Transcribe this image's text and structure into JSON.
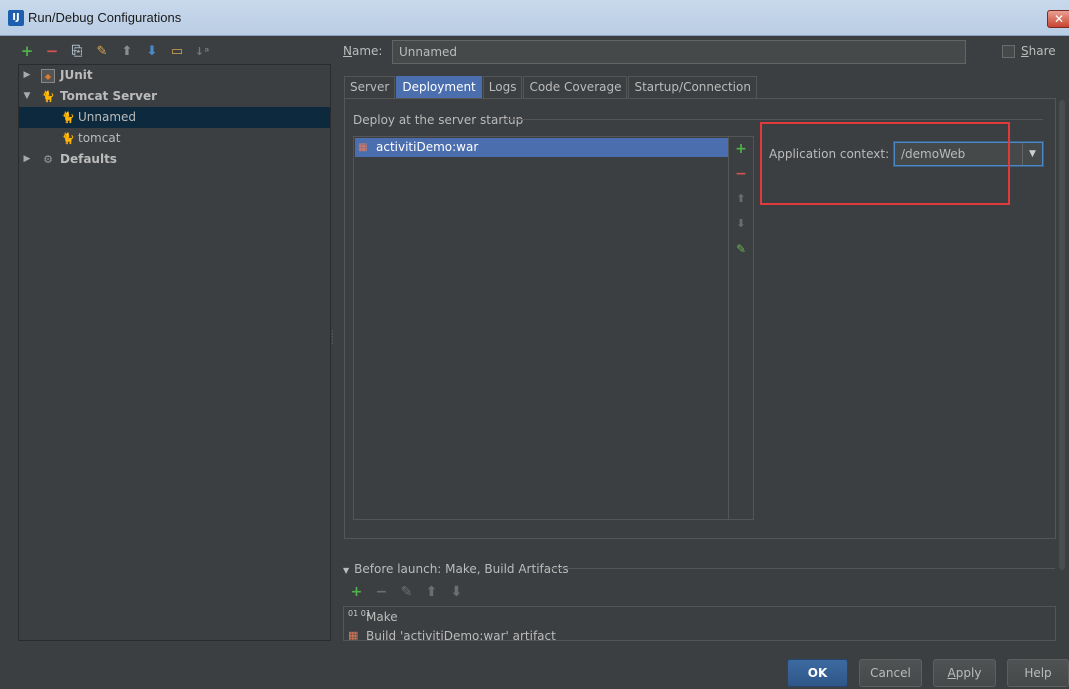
{
  "window": {
    "title": "Run/Debug Configurations",
    "app_icon": "IJ",
    "close_glyph": "✕"
  },
  "left_toolbar": {
    "icons": [
      "add-icon",
      "remove-icon",
      "copy-icon",
      "wrench-icon",
      "move-up-icon",
      "move-down-icon",
      "folder-icon",
      "sort-icon"
    ],
    "glyphs": {
      "add": "+",
      "remove": "−",
      "copy": "⎘",
      "wrench": "✎",
      "up": "⬆",
      "down": "⬇",
      "folder": "▭",
      "sort": "↓ᵃ"
    }
  },
  "tree": {
    "items": [
      {
        "label": "JUnit",
        "bold": true,
        "expanded": false,
        "icon": "junit-icon"
      },
      {
        "label": "Tomcat Server",
        "bold": true,
        "expanded": true,
        "icon": "tomcat-icon"
      },
      {
        "label": "Unnamed",
        "bold": false,
        "selected": true,
        "icon": "tomcat-icon"
      },
      {
        "label": "tomcat",
        "bold": false,
        "icon": "tomcat-icon"
      },
      {
        "label": "Defaults",
        "bold": true,
        "expanded": false,
        "icon": "gear-icon"
      }
    ],
    "arrow_collapsed": "▶",
    "arrow_expanded": "▼"
  },
  "name_field": {
    "label_prefix": "N",
    "label_rest": "ame:",
    "value": "Unnamed"
  },
  "share": {
    "label_prefix": "S",
    "label_rest": "hare",
    "checked": false
  },
  "tabs": [
    {
      "label": "Server",
      "active": false
    },
    {
      "label": "Deployment",
      "active": true
    },
    {
      "label": "Logs",
      "active": false
    },
    {
      "label": "Code Coverage",
      "active": false
    },
    {
      "label": "Startup/Connection",
      "active": false
    }
  ],
  "deployment": {
    "group_title": "Deploy at the server startup",
    "artifacts": [
      "activitiDemo:war"
    ],
    "side_buttons": {
      "add": "+",
      "remove": "−",
      "up": "⬆",
      "down": "⬇",
      "edit": "✎"
    },
    "app_context_label": "Application context:",
    "app_context_value": "/demoWeb",
    "dropdown_glyph": "▼"
  },
  "before_launch": {
    "header": "Before launch: Make, Build Artifacts",
    "triangle": "▼",
    "toolbar": {
      "add": "+",
      "remove": "−",
      "edit": "✎",
      "up": "⬆",
      "down": "⬇"
    },
    "items": [
      {
        "label": "Make",
        "icon": "make-icon",
        "glyph": "01 01"
      },
      {
        "label": "Build 'activitiDemo:war' artifact",
        "icon": "artifact-icon",
        "glyph": "▦"
      }
    ]
  },
  "buttons": {
    "ok": "OK",
    "cancel": "Cancel",
    "apply_prefix": "A",
    "apply_rest": "pply",
    "help": "Help"
  },
  "colors": {
    "background": "#3c3f41",
    "selection": "#4b6eaf",
    "tree_selection": "#0d293e",
    "highlight_box": "#e03a3a",
    "add_green": "#4fb24a",
    "remove_red": "#d25252"
  }
}
